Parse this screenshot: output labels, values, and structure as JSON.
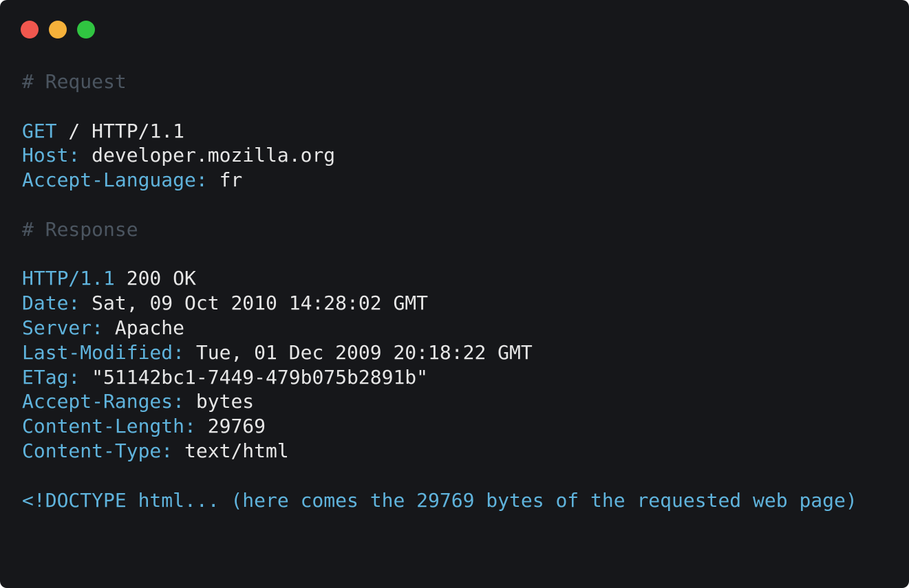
{
  "window": {
    "colors": {
      "background": "#16171a",
      "close": "#f0574e",
      "minimize": "#f5b13a",
      "maximize": "#30c441",
      "key": "#5fb3dc",
      "value": "#e6e6e6",
      "comment": "#4b5560"
    }
  },
  "request": {
    "comment": "# Request",
    "request_line": {
      "method": "GET",
      "rest": " / HTTP/1.1"
    },
    "headers": [
      {
        "name": "Host:",
        "value": " developer.mozilla.org"
      },
      {
        "name": "Accept-Language:",
        "value": " fr"
      }
    ]
  },
  "response": {
    "comment": "# Response",
    "status_line": {
      "version": "HTTP/1.1",
      "rest": " 200 OK"
    },
    "headers": [
      {
        "name": "Date:",
        "value": " Sat, 09 Oct 2010 14:28:02 GMT"
      },
      {
        "name": "Server:",
        "value": " Apache"
      },
      {
        "name": "Last-Modified:",
        "value": " Tue, 01 Dec 2009 20:18:22 GMT"
      },
      {
        "name": "ETag:",
        "value": " \"51142bc1-7449-479b075b2891b\""
      },
      {
        "name": "Accept-Ranges:",
        "value": " bytes"
      },
      {
        "name": "Content-Length:",
        "value": " 29769"
      },
      {
        "name": "Content-Type:",
        "value": " text/html"
      }
    ],
    "body": "<!DOCTYPE html... (here comes the 29769 bytes of the requested web page)"
  }
}
